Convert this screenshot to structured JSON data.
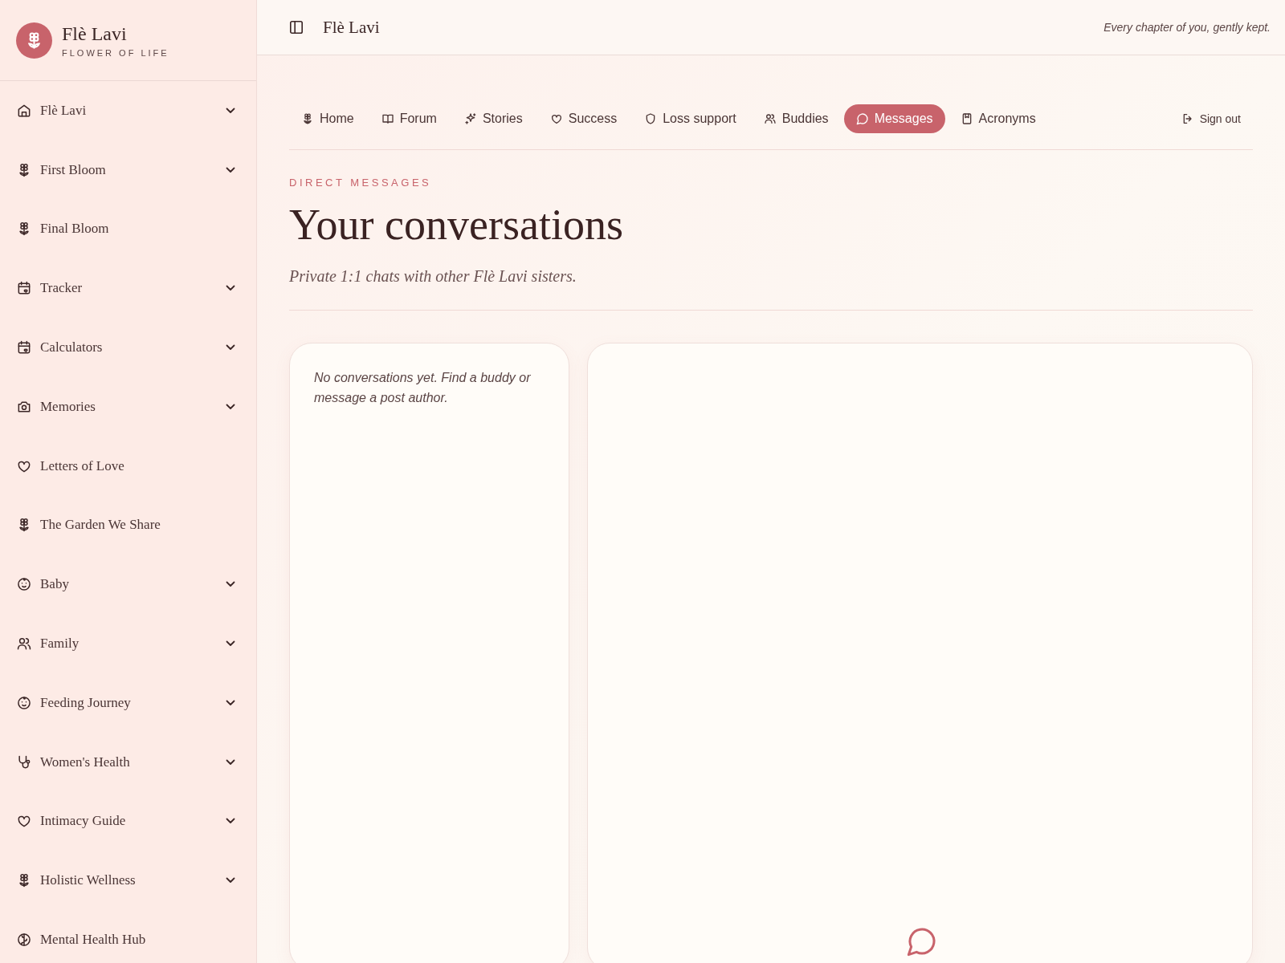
{
  "brand": {
    "name": "Flè Lavi",
    "tagline": "FLOWER OF LIFE"
  },
  "sidebar": {
    "items": [
      {
        "label": "Flè Lavi",
        "has_submenu": true
      },
      {
        "label": "First Bloom",
        "has_submenu": true
      },
      {
        "label": "Final Bloom",
        "has_submenu": false
      },
      {
        "label": "Tracker",
        "has_submenu": true
      },
      {
        "label": "Calculators",
        "has_submenu": true
      },
      {
        "label": "Memories",
        "has_submenu": true
      },
      {
        "label": "Letters of Love",
        "has_submenu": false
      },
      {
        "label": "The Garden We Share",
        "has_submenu": false
      },
      {
        "label": "Baby",
        "has_submenu": true
      },
      {
        "label": "Family",
        "has_submenu": true
      },
      {
        "label": "Feeding Journey",
        "has_submenu": true
      },
      {
        "label": "Women's Health",
        "has_submenu": true
      },
      {
        "label": "Intimacy Guide",
        "has_submenu": true
      },
      {
        "label": "Holistic Wellness",
        "has_submenu": true
      },
      {
        "label": "Mental Health Hub",
        "has_submenu": false
      }
    ]
  },
  "topbar": {
    "title": "Flè Lavi",
    "motto": "Every chapter of you, gently kept."
  },
  "tabs": [
    {
      "label": "Home",
      "selected": false
    },
    {
      "label": "Forum",
      "selected": false
    },
    {
      "label": "Stories",
      "selected": false
    },
    {
      "label": "Success",
      "selected": false
    },
    {
      "label": "Loss support",
      "selected": false
    },
    {
      "label": "Buddies",
      "selected": false
    },
    {
      "label": "Messages",
      "selected": true
    },
    {
      "label": "Acronyms",
      "selected": false
    }
  ],
  "sign_out": "Sign out",
  "page": {
    "eyebrow": "DIRECT MESSAGES",
    "title": "Your conversations",
    "subtitle": "Private 1:1 chats with other Flè Lavi sisters."
  },
  "conversations": {
    "empty_text": "No conversations yet. Find a buddy or message a post author."
  }
}
